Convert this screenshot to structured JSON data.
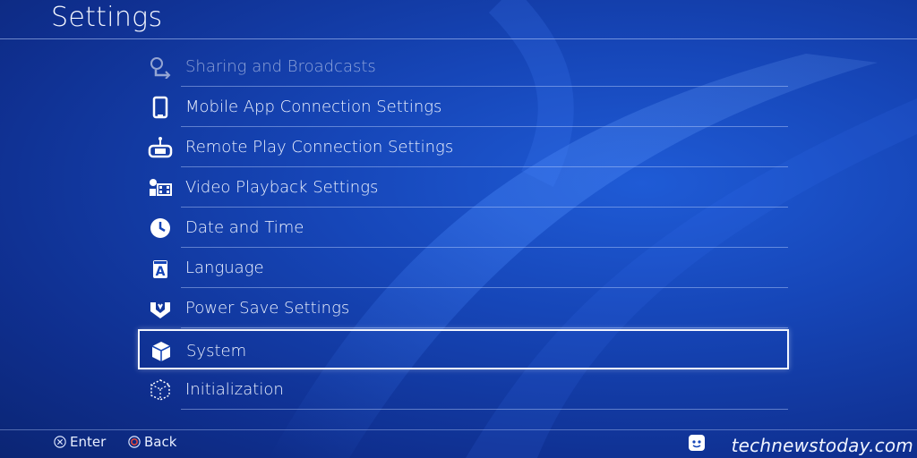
{
  "header": {
    "title": "Settings"
  },
  "menu": {
    "items": [
      {
        "label": "Sharing and Broadcasts",
        "icon": "share-broadcast-icon"
      },
      {
        "label": "Mobile App Connection Settings",
        "icon": "smartphone-icon"
      },
      {
        "label": "Remote Play Connection Settings",
        "icon": "remote-play-icon"
      },
      {
        "label": "Video Playback Settings",
        "icon": "video-playback-icon"
      },
      {
        "label": "Date and Time",
        "icon": "clock-icon"
      },
      {
        "label": "Language",
        "icon": "language-icon"
      },
      {
        "label": "Power Save Settings",
        "icon": "power-save-icon"
      },
      {
        "label": "System",
        "icon": "system-cube-icon"
      },
      {
        "label": "Initialization",
        "icon": "initialization-icon"
      }
    ],
    "selected": "System"
  },
  "footer": {
    "enter_label": "Enter",
    "back_label": "Back",
    "enter_icon": "cross-button-icon",
    "back_icon": "circle-button-icon"
  },
  "watermark": {
    "text": "technewstoday.com"
  },
  "colors": {
    "accent": "#1646b8",
    "selection_border": "#f2f6ff"
  }
}
